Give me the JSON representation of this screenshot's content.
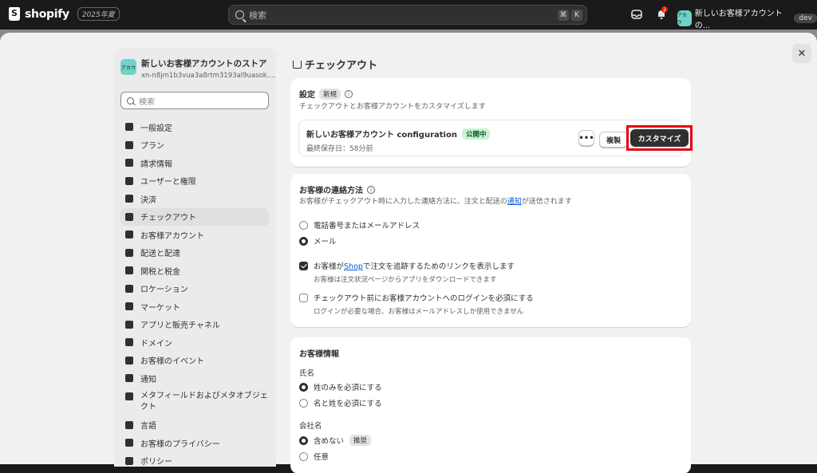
{
  "topbar": {
    "logo_text": "shopify",
    "year_badge": "2025年夏",
    "search_placeholder": "検索",
    "shortcut_key1": "⌘",
    "shortcut_key2": "K",
    "notification_count": "2",
    "store_avatar_text": "アカウ",
    "store_name": "新しいお客様アカウントの...",
    "dev_badge": "dev"
  },
  "sidebar": {
    "store_avatar_text": "アカウ",
    "store_name": "新しいお客様アカウントのストア",
    "store_url": "xn-n8jm1b3vua3a8rtm3193al9uasok....",
    "search_placeholder": "検索",
    "items": [
      {
        "label": "一般設定",
        "icon": "store-icon"
      },
      {
        "label": "プラン",
        "icon": "chart-icon"
      },
      {
        "label": "請求情報",
        "icon": "receipt-icon"
      },
      {
        "label": "ユーザーと権限",
        "icon": "users-icon"
      },
      {
        "label": "決済",
        "icon": "payment-icon"
      },
      {
        "label": "チェックアウト",
        "icon": "cart-icon"
      },
      {
        "label": "お客様アカウント",
        "icon": "person-icon"
      },
      {
        "label": "配送と配達",
        "icon": "truck-icon"
      },
      {
        "label": "関税と税金",
        "icon": "tax-icon"
      },
      {
        "label": "ロケーション",
        "icon": "location-icon"
      },
      {
        "label": "マーケット",
        "icon": "globe-icon"
      },
      {
        "label": "アプリと販売チャネル",
        "icon": "apps-icon"
      },
      {
        "label": "ドメイン",
        "icon": "domain-icon"
      },
      {
        "label": "お客様のイベント",
        "icon": "events-icon"
      },
      {
        "label": "通知",
        "icon": "bell-icon"
      },
      {
        "label": "メタフィールドおよびメタオブジェクト",
        "icon": "metafield-icon"
      },
      {
        "label": "言語",
        "icon": "language-icon"
      },
      {
        "label": "お客様のプライバシー",
        "icon": "lock-icon"
      },
      {
        "label": "ポリシー",
        "icon": "policy-icon"
      }
    ]
  },
  "page": {
    "title": "チェックアウト",
    "close_label": "✕"
  },
  "config_card": {
    "heading": "設定",
    "new_tag": "新規",
    "subtitle": "チェックアウトとお客様アカウントをカスタマイズします",
    "config_name": "新しいお客様アカウント configuration",
    "status": "公開中",
    "last_saved": "最終保存日：58分前",
    "more_label": "•••",
    "duplicate_label": "複製",
    "customize_label": "カスタマイズ"
  },
  "contact_card": {
    "heading": "お客様の連絡方法",
    "subtitle_pre": "お客様がチェックアウト時に入力した連絡方法に、注文と配送の",
    "subtitle_link": "通知",
    "subtitle_post": "が送信されます",
    "option_phone_email": "電話番号またはメールアドレス",
    "option_email": "メール",
    "shop_check_pre": "お客様が",
    "shop_check_link": "Shop",
    "shop_check_post": "で注文を追跡するためのリンクを表示します",
    "shop_check_helper": "お客様は注文状況ページからアプリをダウンロードできます",
    "login_check": "チェックアウト前にお客様アカウントへのログインを必須にする",
    "login_check_helper": "ログインが必要な場合、お客様はメールアドレスしか使用できません"
  },
  "customer_info_card": {
    "heading": "お客様情報",
    "name_label": "氏名",
    "name_option1": "姓のみを必須にする",
    "name_option2": "名と姓を必須にする",
    "company_label": "会社名",
    "company_option1": "含めない",
    "recommended_tag": "推奨",
    "company_option2": "任意"
  }
}
